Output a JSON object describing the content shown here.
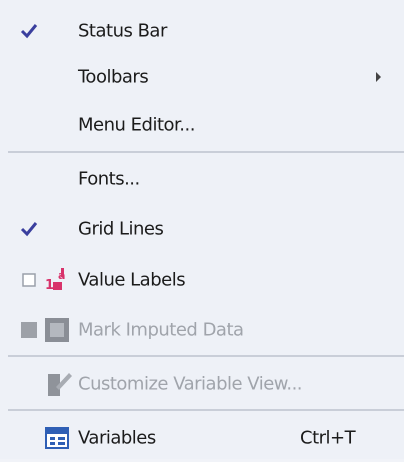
{
  "menu": {
    "items": [
      {
        "label": "Status Bar",
        "checked": true,
        "enabled": true
      },
      {
        "label": "Toolbars",
        "submenu": true,
        "enabled": true
      },
      {
        "label": "Menu Editor...",
        "enabled": true
      },
      {
        "label": "Fonts...",
        "enabled": true
      },
      {
        "label": "Grid Lines",
        "checked": true,
        "enabled": true
      },
      {
        "label": "Value Labels",
        "checked": false,
        "icon": "value-labels-icon",
        "enabled": true
      },
      {
        "label": "Mark Imputed Data",
        "icon": "mark-imputed-data-icon",
        "enabled": false
      },
      {
        "label": "Customize Variable View...",
        "icon": "customize-variable-view-icon",
        "enabled": false
      },
      {
        "label": "Variables",
        "shortcut": "Ctrl+T",
        "icon": "variables-icon",
        "enabled": true
      }
    ]
  },
  "colors": {
    "background": "#eef1f7",
    "separator": "#c9ced8",
    "disabled_text": "#a0a4ab",
    "checkmark": "#3a3f9e",
    "value_labels_icon": "#d8336b"
  }
}
